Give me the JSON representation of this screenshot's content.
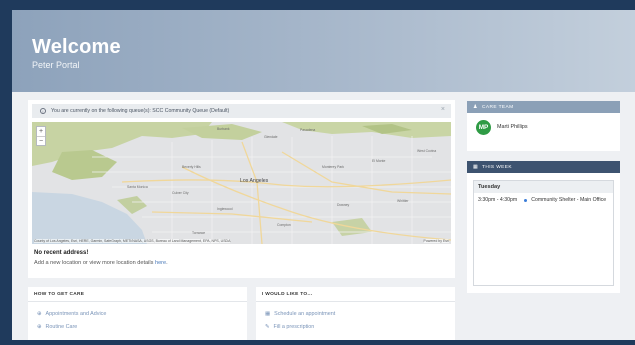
{
  "hero": {
    "title": "Welcome",
    "subtitle": "Peter Portal"
  },
  "queue": {
    "message": "You are currently on the following queue(s): SCC Community Queue (Default)",
    "close_label": "×"
  },
  "map": {
    "zoom_in": "+",
    "zoom_out": "−",
    "attribution": "County of Los Angeles, Esri, HERE, Garmin, SafeGraph, METI/NASA, USGS, Bureau of Land Management, EPA, NPS, USDA",
    "powered_by": "Powered by Esri",
    "city_label": "Los Angeles",
    "place_labels": [
      "Pasadena",
      "Glendale",
      "Burbank",
      "Beverly Hills",
      "Santa Monica",
      "Inglewood",
      "Downey",
      "Monterey Park",
      "El Monte",
      "Whittier",
      "Culver City",
      "Torrance",
      "Compton",
      "West Covina"
    ]
  },
  "address": {
    "title": "No recent address!",
    "hint_prefix": "Add a new location or view more location details ",
    "hint_link": "here",
    "hint_suffix": "."
  },
  "care_team": {
    "header": "CARE TEAM",
    "member_initials": "MP",
    "member_name": "Marti Phillips"
  },
  "this_week": {
    "header": "THIS WEEK",
    "day": "Tuesday",
    "event_time": "3:30pm - 4:30pm",
    "event_title": "Community Shelter - Main Office"
  },
  "how_to_get_care": {
    "title": "HOW TO GET CARE",
    "items": [
      "Appointments and Advice",
      "Routine Care"
    ]
  },
  "i_would_like_to": {
    "title": "I WOULD LIKE TO...",
    "items": [
      "Schedule an appointment",
      "Fill a prescription"
    ]
  },
  "colors": {
    "page_border": "#1f3a5c",
    "care_team_header": "#8ba0b7",
    "this_week_header": "#3d5370",
    "avatar_bg": "#2f9b45",
    "link": "#7a94b8"
  }
}
